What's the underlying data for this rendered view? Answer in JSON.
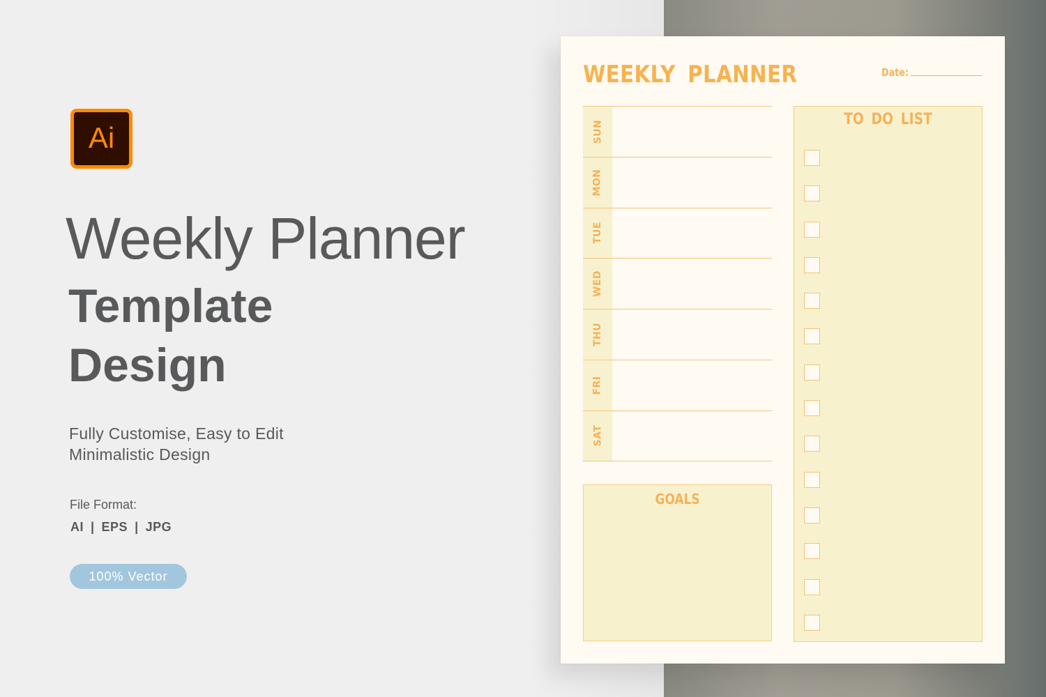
{
  "promo": {
    "logo_text": "Ai",
    "title_line1": "Weekly Planner",
    "title_line2": "Template",
    "title_line3": "Design",
    "subtitle_line1": "Fully Customise, Easy to Edit",
    "subtitle_line2": "Minimalistic Design",
    "file_format_label": "File Format:",
    "file_formats": [
      "AI",
      "EPS",
      "JPG"
    ],
    "separator": "|",
    "badge": "100% Vector",
    "colors": {
      "logo_bg": "#2f0e00",
      "logo_accent": "#ff8a00",
      "text": "#58595b",
      "badge_bg": "#a3c6df"
    }
  },
  "planner": {
    "title": "WEEKLY PLANNER",
    "date_label": "Date:",
    "days": [
      "SUN",
      "MON",
      "TUE",
      "WED",
      "THU",
      "FRI",
      "SAT"
    ],
    "goals_title": "GOALS",
    "todo_title": "TO DO LIST",
    "todo_items": [
      {
        "checked": false
      },
      {
        "checked": false
      },
      {
        "checked": false
      },
      {
        "checked": false
      },
      {
        "checked": false
      },
      {
        "checked": false
      },
      {
        "checked": false
      },
      {
        "checked": false
      },
      {
        "checked": false
      },
      {
        "checked": false
      },
      {
        "checked": false
      },
      {
        "checked": false
      },
      {
        "checked": false
      },
      {
        "checked": false
      }
    ],
    "colors": {
      "accent": "#f4b25b",
      "paper": "#fffaf2",
      "panel_fill": "#f8f1cd",
      "line": "#f5c27a"
    }
  }
}
